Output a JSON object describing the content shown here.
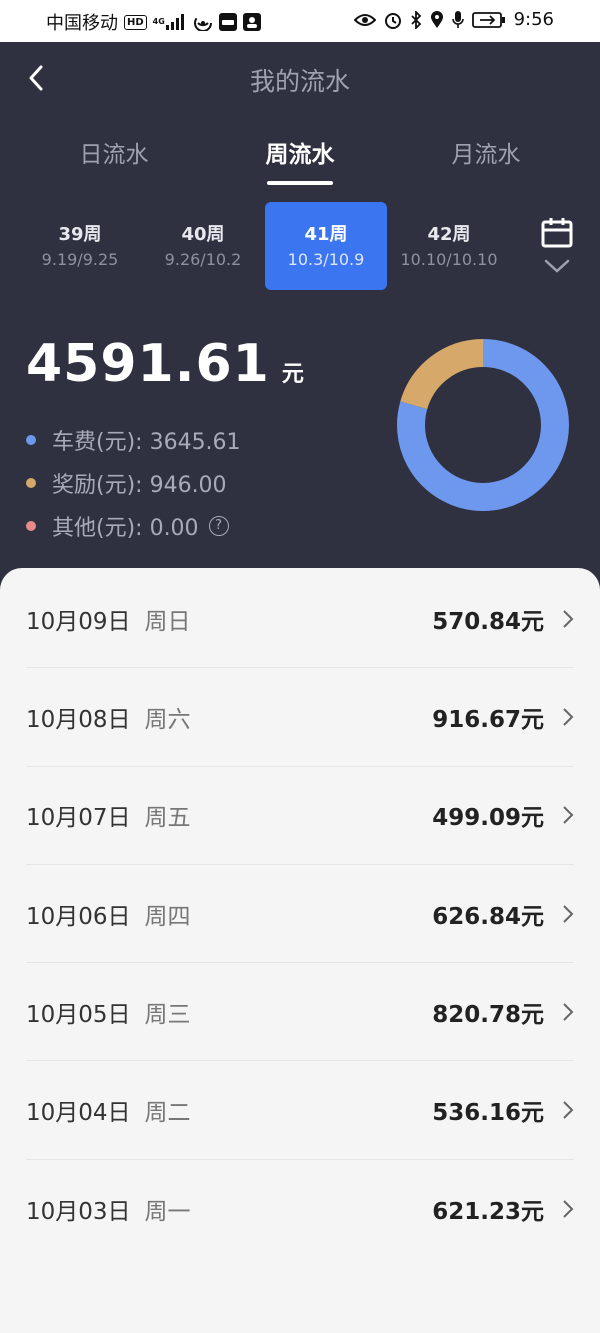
{
  "status_bar": {
    "carrier": "中国移动",
    "hd": "HD",
    "network": "4G",
    "time": "9:56"
  },
  "header": {
    "title": "我的流水"
  },
  "tabs": [
    {
      "label": "日流水",
      "active": false
    },
    {
      "label": "周流水",
      "active": true
    },
    {
      "label": "月流水",
      "active": false
    }
  ],
  "weeks": [
    {
      "label": "39周",
      "range": "9.19/9.25",
      "selected": false
    },
    {
      "label": "40周",
      "range": "9.26/10.2",
      "selected": false
    },
    {
      "label": "41周",
      "range": "10.3/10.9",
      "selected": true
    },
    {
      "label": "42周",
      "range": "10.10/10.10",
      "selected": false
    }
  ],
  "summary": {
    "total": "4591.61",
    "unit": "元",
    "legend": [
      {
        "label": "车费(元): 3645.61",
        "color": "#6e97ee"
      },
      {
        "label": "奖励(元): 946.00",
        "color": "#d6a86a"
      },
      {
        "label": "其他(元): 0.00",
        "color": "#e88a8a"
      }
    ],
    "help_glyph": "?"
  },
  "chart_data": {
    "type": "pie",
    "categories": [
      "车费",
      "奖励",
      "其他"
    ],
    "values": [
      3645.61,
      946.0,
      0.0
    ],
    "colors": [
      "#6e97ee",
      "#d6a86a",
      "#e88a8a"
    ],
    "donut": true
  },
  "daily_list": [
    {
      "date": "10月09日",
      "weekday": "周日",
      "amount": "570.84元"
    },
    {
      "date": "10月08日",
      "weekday": "周六",
      "amount": "916.67元"
    },
    {
      "date": "10月07日",
      "weekday": "周五",
      "amount": "499.09元"
    },
    {
      "date": "10月06日",
      "weekday": "周四",
      "amount": "626.84元"
    },
    {
      "date": "10月05日",
      "weekday": "周三",
      "amount": "820.78元"
    },
    {
      "date": "10月04日",
      "weekday": "周二",
      "amount": "536.16元"
    },
    {
      "date": "10月03日",
      "weekday": "周一",
      "amount": "621.23元"
    }
  ]
}
